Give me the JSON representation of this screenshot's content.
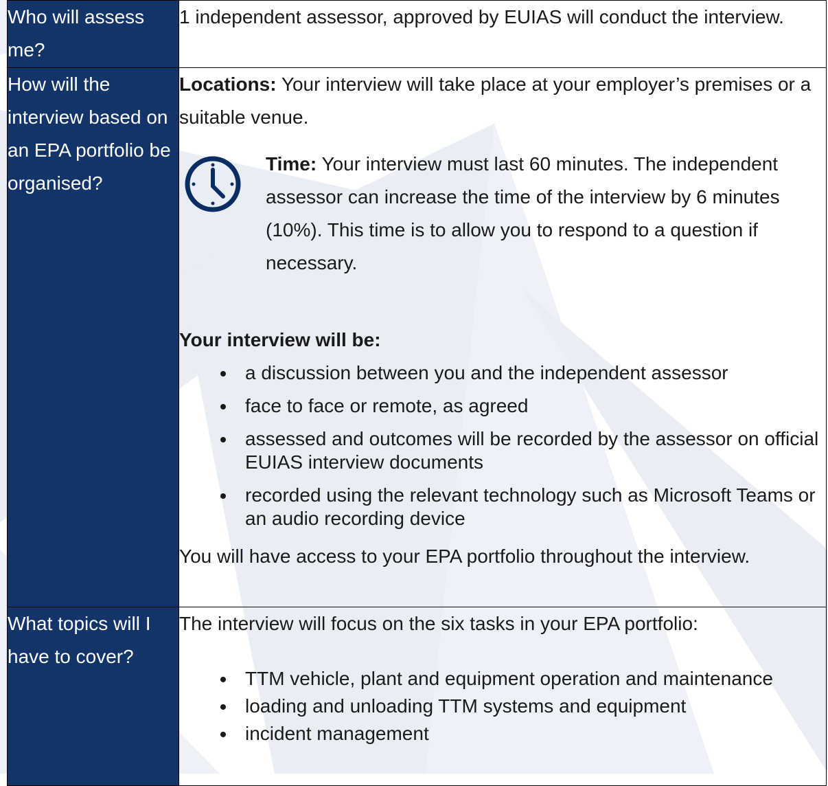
{
  "rows": [
    {
      "question": "Who will assess me?",
      "answer": "1 independent assessor, approved by EUIAS will conduct the interview."
    },
    {
      "question": "How will the interview based on an EPA portfolio be organised?",
      "locations_label": "Locations:",
      "locations_text": " Your interview will take place at your employer’s premises or a suitable venue.",
      "time_icon": "clock-icon",
      "time_label": "Time:",
      "time_text": " Your interview must last 60 minutes. The independent assessor can increase the time of the interview by 6 minutes (10%). This time is to allow you to respond to a question if necessary.",
      "list_heading": "Your interview will be:",
      "bullets": [
        "a discussion between you and the independent assessor",
        "face to face or remote, as agreed",
        "assessed and outcomes will be recorded by the assessor on official EUIAS interview documents",
        "recorded using the relevant technology such as Microsoft Teams or an audio recording device"
      ],
      "closing": "You will have access to your EPA portfolio throughout the interview."
    },
    {
      "question": "What topics will I have to cover?",
      "intro": "The interview will focus on the six tasks in your EPA portfolio:",
      "tasks": [
        "TTM vehicle, plant and equipment operation and maintenance",
        "loading and unloading TTM systems and equipment",
        "incident management"
      ]
    }
  ],
  "colors": {
    "question_bg": "#0a2d64",
    "question_text": "#ffffff",
    "icon": "#0a2d64",
    "watermark": "#e6ebf3"
  }
}
